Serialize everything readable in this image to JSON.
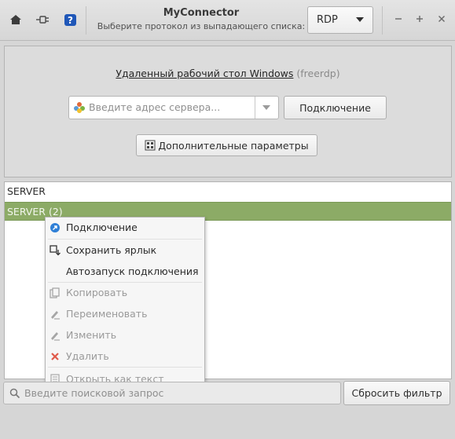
{
  "header": {
    "title": "MyConnector",
    "subtitle": "Выберите протокол из выпадающего списка:",
    "protocol": "RDP"
  },
  "main": {
    "connection_title": "Удаленный рабочий стол Windows",
    "connection_variant": "(freerdp)",
    "server_placeholder": "Введите адрес сервера...",
    "connect_button": "Подключение",
    "advanced_button": "Дополнительные параметры"
  },
  "list": {
    "rows": [
      "SERVER",
      "SERVER (2)"
    ]
  },
  "context_menu": {
    "items": [
      {
        "label": "Подключение",
        "icon": "connect-icon"
      },
      {
        "label": "Сохранить ярлык",
        "icon": "shortcut-icon"
      },
      {
        "label": "Автозапуск подключения",
        "icon": ""
      },
      {
        "label": "Копировать",
        "icon": "copy-icon"
      },
      {
        "label": "Переименовать",
        "icon": "rename-icon"
      },
      {
        "label": "Изменить",
        "icon": "edit-icon"
      },
      {
        "label": "Удалить",
        "icon": "delete-icon"
      },
      {
        "label": "Открыть как текст",
        "icon": "text-file-icon"
      }
    ]
  },
  "footer": {
    "search_placeholder": "Введите поисковой запрос",
    "reset_button": "Сбросить фильтр"
  },
  "colors": {
    "selection": "#8cab66",
    "accent_icon": "#2f7fd6",
    "delete_icon": "#e05a4a"
  }
}
